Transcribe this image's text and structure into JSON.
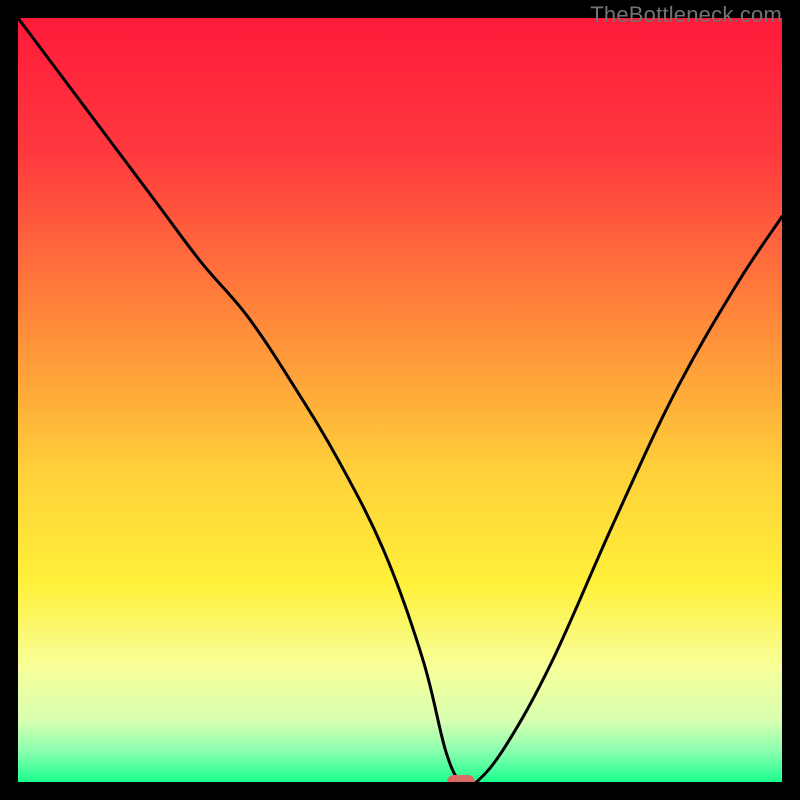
{
  "watermark": "TheBottleneck.com",
  "colors": {
    "frame": "#000000",
    "marker": "#d96a64",
    "curve": "#000000",
    "gradient_stops": [
      {
        "pct": 0,
        "color": "#ff1a3a"
      },
      {
        "pct": 18,
        "color": "#ff3a3f"
      },
      {
        "pct": 40,
        "color": "#ff8a3a"
      },
      {
        "pct": 60,
        "color": "#ffd23a"
      },
      {
        "pct": 74,
        "color": "#fff03a"
      },
      {
        "pct": 85,
        "color": "#f7ff9a"
      },
      {
        "pct": 92,
        "color": "#d8ffb0"
      },
      {
        "pct": 96,
        "color": "#8affb0"
      },
      {
        "pct": 100,
        "color": "#1aff8c"
      }
    ]
  },
  "chart_data": {
    "type": "line",
    "title": "",
    "xlabel": "",
    "ylabel": "",
    "xlim": [
      0,
      100
    ],
    "ylim": [
      0,
      100
    ],
    "legend": false,
    "grid": false,
    "marker": {
      "x": 58,
      "y": 0
    },
    "series": [
      {
        "name": "bottleneck-curve",
        "x": [
          0,
          6,
          12,
          18,
          24,
          30,
          36,
          42,
          48,
          53,
          56,
          58,
          60,
          64,
          70,
          78,
          86,
          94,
          100
        ],
        "y": [
          100,
          92,
          84,
          76,
          68,
          61,
          52,
          42,
          30,
          16,
          4,
          0,
          0,
          5,
          16,
          34,
          51,
          65,
          74
        ]
      }
    ]
  }
}
